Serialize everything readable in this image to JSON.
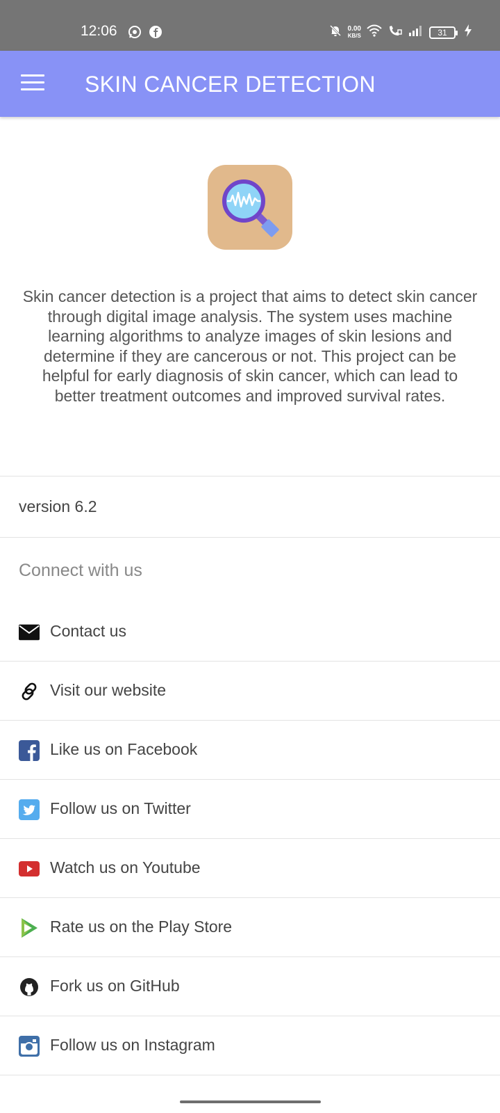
{
  "status_bar": {
    "time": "12:06",
    "net_speed_value": "0.00",
    "net_speed_unit": "KB/S",
    "battery_level": "31",
    "icons": [
      "whatsapp-icon",
      "facebook-icon",
      "mute-icon",
      "wifi-icon",
      "wifi-call-icon",
      "signal-icon",
      "battery-icon",
      "charging-icon"
    ]
  },
  "app_bar": {
    "title": "SKIN CANCER DETECTION",
    "menu_icon": "hamburger-menu-icon",
    "background_color": "#8892f6"
  },
  "about": {
    "logo_icon": "magnifier-scan-icon",
    "description": "Skin cancer detection is a project that aims to detect skin cancer through digital image analysis. The system uses machine learning algorithms to analyze images of skin lesions and determine if they are cancerous or not. This project can be helpful for early diagnosis of skin cancer, which can lead to better treatment outcomes and improved survival rates.",
    "version": "version 6.2"
  },
  "connect": {
    "heading": "Connect with us",
    "items": [
      {
        "label": "Contact us",
        "icon": "envelope-icon"
      },
      {
        "label": "Visit our website",
        "icon": "link-icon"
      },
      {
        "label": "Like us on Facebook",
        "icon": "facebook-icon",
        "color": "#3b5998"
      },
      {
        "label": "Follow us on Twitter",
        "icon": "twitter-icon",
        "color": "#55acee"
      },
      {
        "label": "Watch us on Youtube",
        "icon": "youtube-icon",
        "color": "#d32f2f"
      },
      {
        "label": "Rate us on the Play Store",
        "icon": "play-store-icon",
        "color": "#4caf50"
      },
      {
        "label": "Fork us on GitHub",
        "icon": "github-icon",
        "color": "#222222"
      },
      {
        "label": "Follow us on Instagram",
        "icon": "instagram-icon",
        "color": "#3f6fa8"
      }
    ]
  }
}
